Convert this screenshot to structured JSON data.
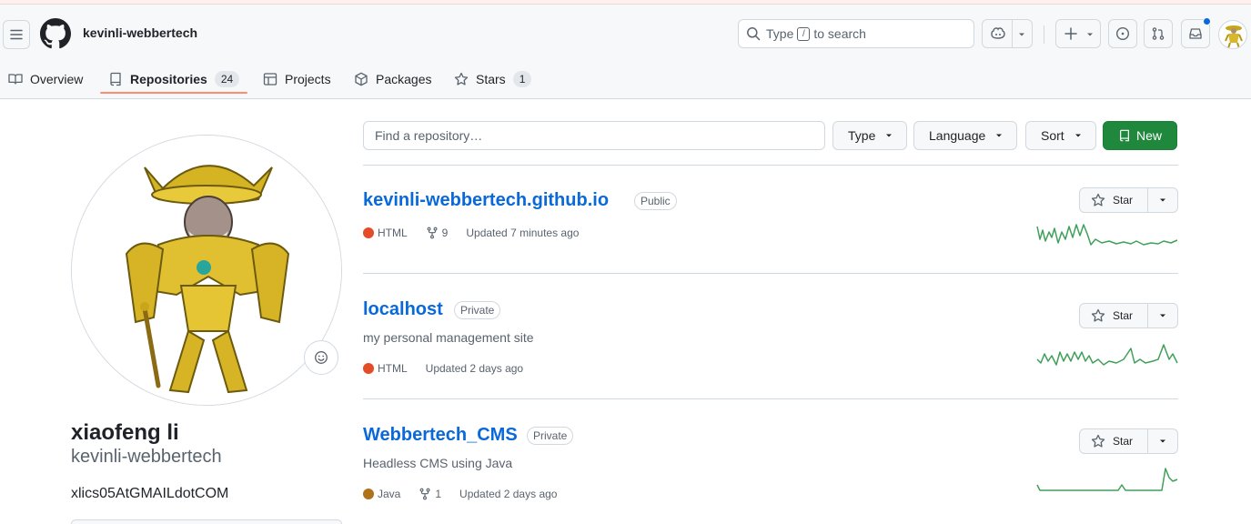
{
  "header": {
    "username": "kevinli-webbertech",
    "search": {
      "prefix": "Type",
      "key": "/",
      "suffix": "to search"
    }
  },
  "tabs": [
    {
      "label": "Overview"
    },
    {
      "label": "Repositories",
      "count": "24"
    },
    {
      "label": "Projects"
    },
    {
      "label": "Packages"
    },
    {
      "label": "Stars",
      "count": "1"
    }
  ],
  "profile": {
    "fullname": "xiaofeng li",
    "login": "kevinli-webbertech",
    "bio": "xlics05AtGMAILdotCOM"
  },
  "toolbar": {
    "filter_placeholder": "Find a repository…",
    "type_label": "Type",
    "language_label": "Language",
    "sort_label": "Sort",
    "new_label": "New"
  },
  "repos": [
    {
      "name": "kevinli-webbertech.github.io",
      "visibility": "Public",
      "description": "",
      "language": "HTML",
      "language_color": "#e34c26",
      "forks": "9",
      "updated": "Updated 7 minutes ago",
      "star_label": "Star"
    },
    {
      "name": "localhost",
      "visibility": "Private",
      "description": "my personal management site",
      "language": "HTML",
      "language_color": "#e34c26",
      "forks": "",
      "updated": "Updated 2 days ago",
      "star_label": "Star"
    },
    {
      "name": "Webbertech_CMS",
      "visibility": "Private",
      "description": "Headless CMS using Java",
      "language": "Java",
      "language_color": "#b07219",
      "forks": "1",
      "updated": "Updated 2 days ago",
      "star_label": "Star"
    }
  ],
  "colors": {
    "accent": "#0969da",
    "new_button": "#1f883d",
    "tab_underline": "#fd8c73",
    "sparkline": "#40a05a"
  }
}
